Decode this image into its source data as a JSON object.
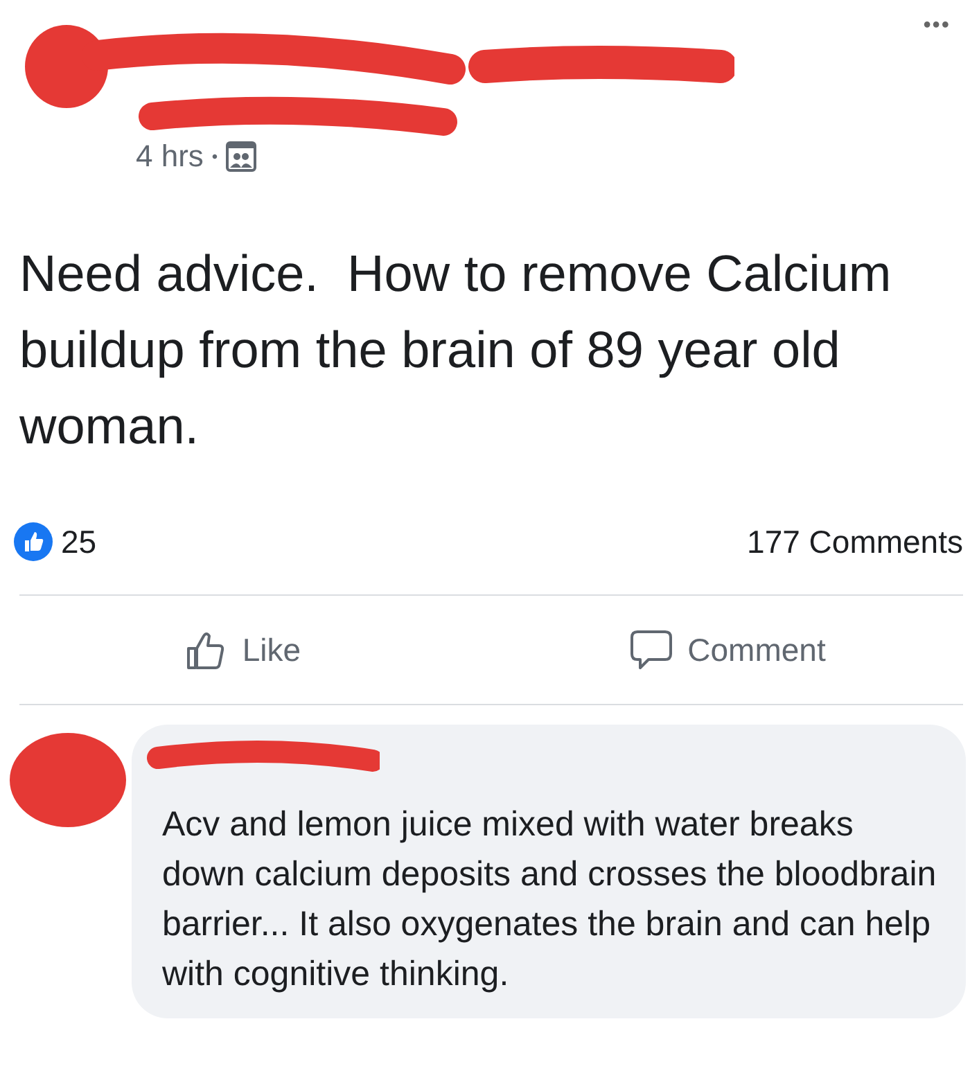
{
  "post": {
    "time": "4 hrs",
    "separator": "•",
    "text": "Need advice.  How to remove Calcium buildup from the brain of 89 year old woman.",
    "more": "•••"
  },
  "stats": {
    "likes": "25",
    "comments": "177 Comments"
  },
  "actions": [
    {
      "kind": "like",
      "label": "Like"
    },
    {
      "kind": "comment",
      "label": "Comment"
    }
  ],
  "comment": {
    "text": "Acv and lemon juice mixed with water breaks down calcium deposits and crosses the bloodbrain barrier... It also oxygenates the brain and can help with cognitive thinking."
  }
}
